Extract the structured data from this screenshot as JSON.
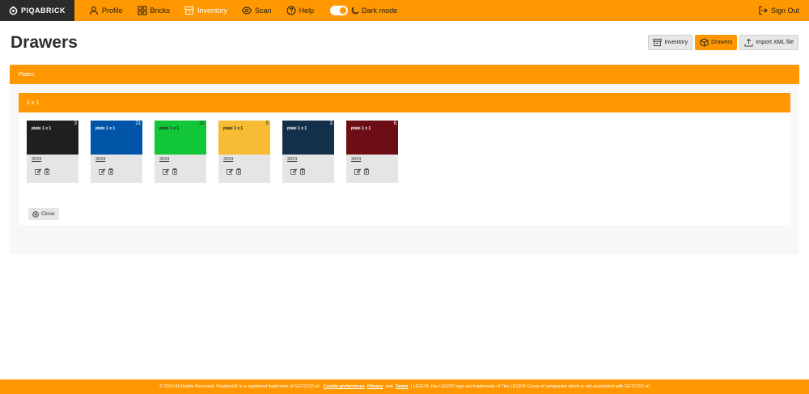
{
  "brand": {
    "name": "PIQABRICK"
  },
  "nav": [
    {
      "label": "Profile",
      "icon": "user-icon"
    },
    {
      "label": "Bricks",
      "icon": "grid-icon"
    },
    {
      "label": "Inventory",
      "icon": "archive-icon",
      "active": true
    },
    {
      "label": "Scan",
      "icon": "eye-icon"
    },
    {
      "label": "Help",
      "icon": "question-icon"
    }
  ],
  "dark_mode": {
    "label": "Dark mode"
  },
  "signout": {
    "label": "Sign Out"
  },
  "page": {
    "title": "Drawers"
  },
  "actions": {
    "inventory": "Inventory",
    "drawers": "Drawers",
    "import": "Import XML file"
  },
  "group": {
    "title": "Plates",
    "subgroup": "1 x 1"
  },
  "bricks": [
    {
      "name": "plate 1 x 1",
      "count": "3",
      "code": "3024",
      "color": "#1f1f1f",
      "text": "#ffffff"
    },
    {
      "name": "plate 1 x 1",
      "count": "21",
      "code": "3024",
      "color": "#0055a8",
      "text": "#ffffff"
    },
    {
      "name": "plate 1 x 1",
      "count": "32",
      "code": "3024",
      "color": "#11c637",
      "text": "#1b1b1b"
    },
    {
      "name": "plate 1 x 1",
      "count": "5",
      "code": "3024",
      "color": "#f7bb34",
      "text": "#1b1b1b"
    },
    {
      "name": "plate 1 x 1",
      "count": "3",
      "code": "3024",
      "color": "#13304a",
      "text": "#ffffff"
    },
    {
      "name": "plate 1 x 1",
      "count": "6",
      "code": "3024",
      "color": "#6d0e16",
      "text": "#ffffff"
    }
  ],
  "close": {
    "label": "Close"
  },
  "footer": {
    "prefix": "© 2020 All Rights Reserved. Piqabrick® is a registered trademark of GETCOO srl.",
    "cookie": "Cookie preferences",
    "privacy": "Privacy",
    "and": "and",
    "terms": "Terms",
    "suffix": "| LEGO®, the LEGO® logo are trademarks of The LEGO® Group of companies which is not associated with GETCOO srl"
  },
  "colors": {
    "accent": "#ff9800",
    "logo_bg": "#2b2b2b"
  }
}
